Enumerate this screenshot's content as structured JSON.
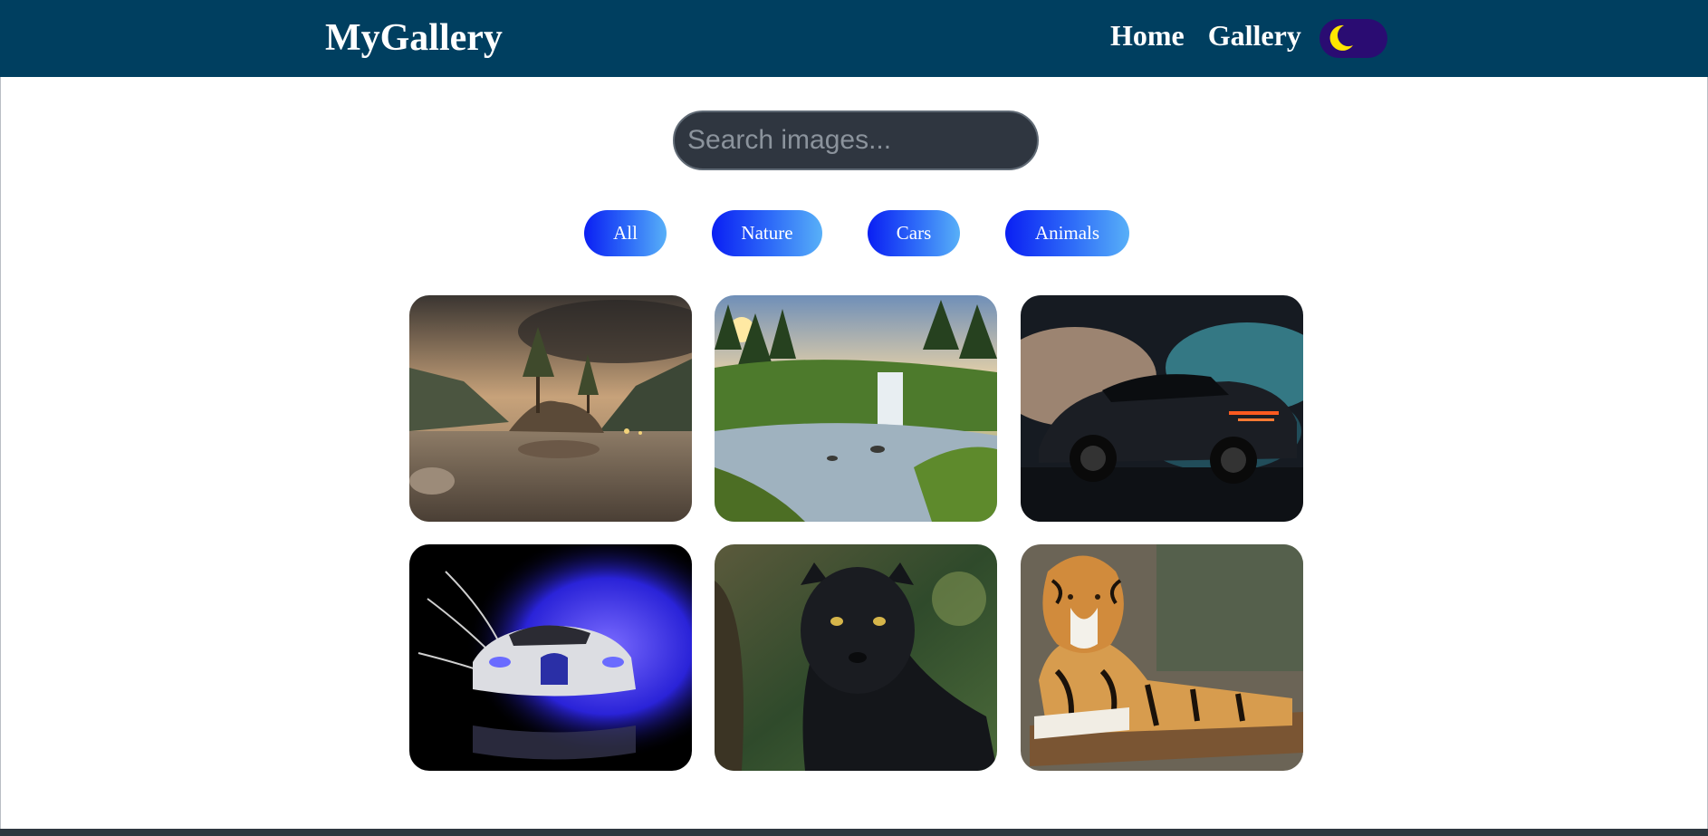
{
  "header": {
    "brand": "MyGallery",
    "nav": [
      {
        "label": "Home"
      },
      {
        "label": "Gallery"
      }
    ],
    "theme_toggle": {
      "icon": "moon-icon",
      "mode": "dark-mode-toggle"
    }
  },
  "search": {
    "placeholder": "Search images...",
    "value": ""
  },
  "filters": [
    {
      "label": "All"
    },
    {
      "label": "Nature"
    },
    {
      "label": "Cars"
    },
    {
      "label": "Animals"
    }
  ],
  "gallery": {
    "images": [
      {
        "category": "Nature"
      },
      {
        "category": "Nature"
      },
      {
        "category": "Cars"
      },
      {
        "category": "Cars"
      },
      {
        "category": "Animals"
      },
      {
        "category": "Animals"
      }
    ]
  },
  "colors": {
    "navbar": "#003f60",
    "toggle": "#2a0c72",
    "moon": "#ffe600",
    "filter_gradient_start": "#0a1ff3",
    "filter_gradient_end": "#58b0f8",
    "search_bg": "#2f3640"
  }
}
